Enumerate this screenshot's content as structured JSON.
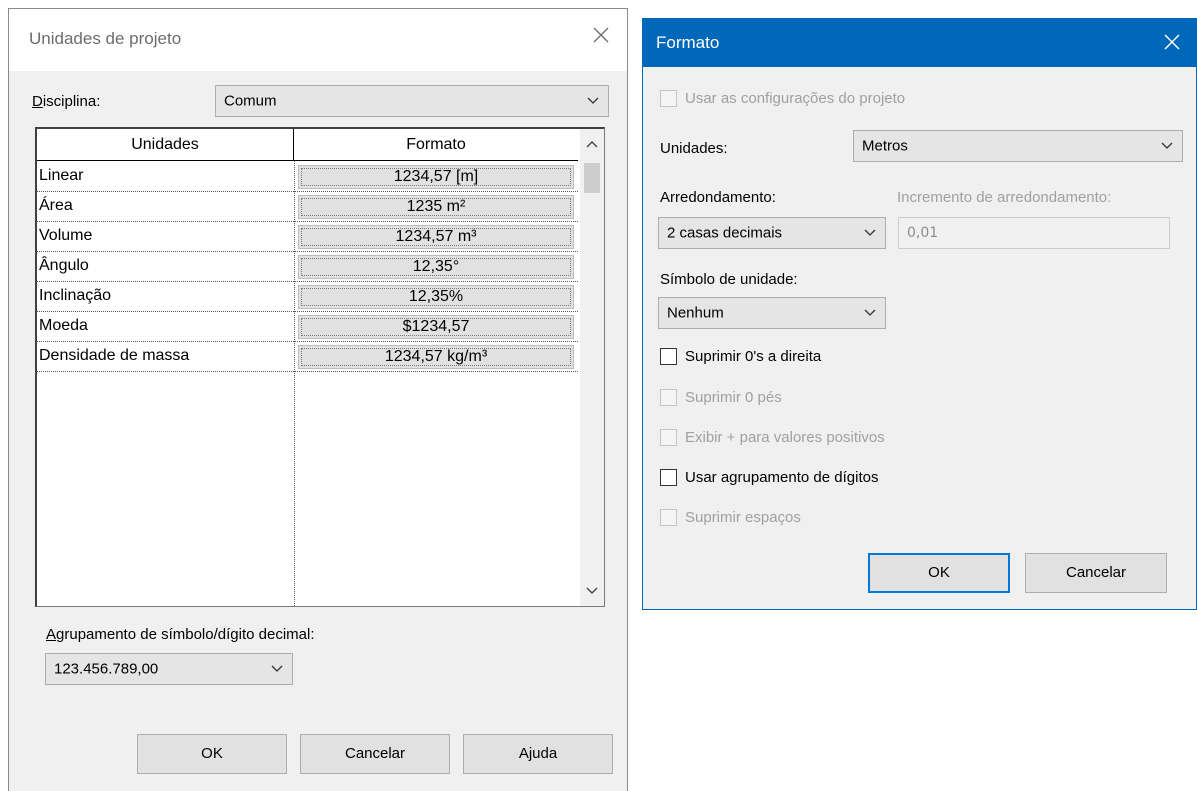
{
  "project_units": {
    "title": "Unidades de projeto",
    "discipline_label": "Disciplina:",
    "discipline_value": "Comum",
    "table": {
      "headers": [
        "Unidades",
        "Formato"
      ],
      "rows": [
        {
          "unit": "Linear",
          "format": "1234,57 [m]"
        },
        {
          "unit": "Área",
          "format": "1235 m²"
        },
        {
          "unit": "Volume",
          "format": "1234,57 m³"
        },
        {
          "unit": "Ângulo",
          "format": "12,35°"
        },
        {
          "unit": "Inclinação",
          "format": "12,35%"
        },
        {
          "unit": "Moeda",
          "format": "$1234,57"
        },
        {
          "unit": "Densidade de massa",
          "format": "1234,57 kg/m³"
        }
      ]
    },
    "grouping_label": "Agrupamento de símbolo/dígito decimal:",
    "grouping_value": "123.456.789,00",
    "buttons": {
      "ok": "OK",
      "cancel": "Cancelar",
      "help": "Ajuda"
    }
  },
  "format": {
    "title": "Formato",
    "use_project_settings": "Usar as configurações do projeto",
    "units_label": "Unidades:",
    "units_value": "Metros",
    "rounding_label": "Arredondamento:",
    "rounding_value": "2 casas decimais",
    "rounding_increment_label": "Incremento de arredondamento:",
    "rounding_increment_value": "0,01",
    "unit_symbol_label": "Símbolo de unidade:",
    "unit_symbol_value": "Nenhum",
    "suppress_trailing_zeros": "Suprimir 0's a direita",
    "suppress_zero_feet": "Suprimir 0 pés",
    "show_plus_positive": "Exibir + para valores positivos",
    "use_digit_grouping": "Usar agrupamento de dígitos",
    "suppress_spaces": "Suprimir espaços",
    "buttons": {
      "ok": "OK",
      "cancel": "Cancelar"
    }
  },
  "colors": {
    "title_bar_active": "#0068b8",
    "dialog_bg": "#f0f0f0",
    "default_button_border": "#0078d7"
  }
}
